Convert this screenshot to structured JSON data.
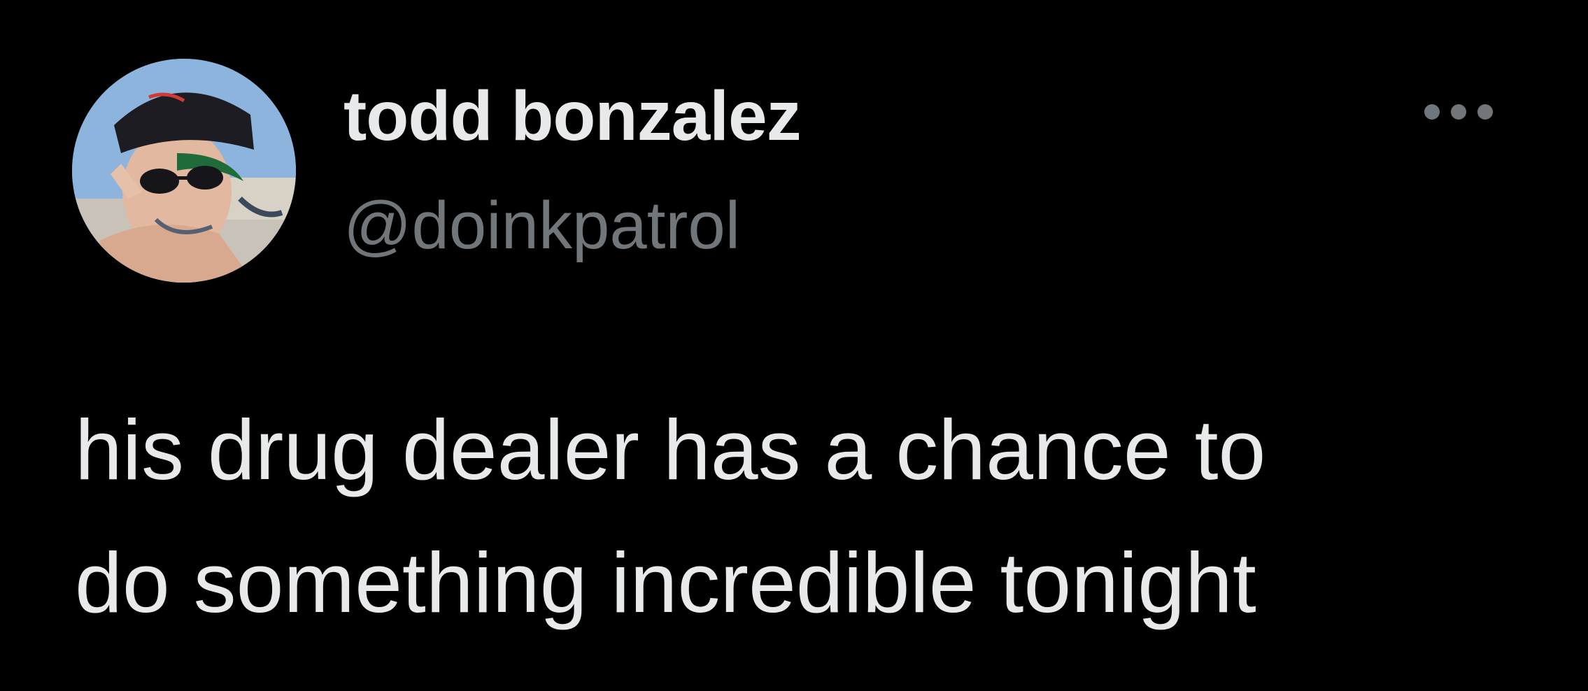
{
  "tweet": {
    "author": {
      "display_name": "todd bonzalez",
      "handle": "@doinkpatrol",
      "avatar_icon": "profile-photo"
    },
    "more_icon": "more-horizontal-icon",
    "text_lines": [
      "his drug dealer has a chance to",
      "do something incredible tonight"
    ]
  },
  "colors": {
    "background": "#000000",
    "primary_text": "#e7e9ea",
    "secondary_text": "#71767b"
  }
}
